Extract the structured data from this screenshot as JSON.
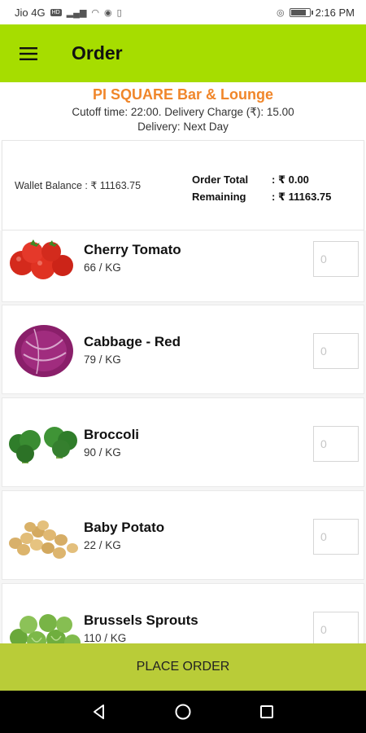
{
  "status_bar": {
    "carrier": "Jio 4G",
    "network_badge": "HD",
    "battery_level": 0.85,
    "time": "2:16 PM"
  },
  "app_bar": {
    "title": "Order",
    "menu_icon": "hamburger-menu-icon"
  },
  "store": {
    "name": "PI SQUARE Bar & Lounge",
    "cutoff_line": "Cutoff time: 22:00. Delivery Charge (₹): 15.00",
    "delivery_line": "Delivery: Next Day"
  },
  "wallet": {
    "balance_text": "Wallet Balance  : ₹ 11163.75",
    "order_total_label": "Order Total",
    "order_total_value": ": ₹ 0.00",
    "remaining_label": "Remaining",
    "remaining_value": ": ₹ 11163.75"
  },
  "products": [
    {
      "name": "Cherry Tomato",
      "price": "66 / KG",
      "qty_placeholder": "0",
      "image": "cherry-tomato"
    },
    {
      "name": "Cabbage - Red",
      "price": "79 / KG",
      "qty_placeholder": "0",
      "image": "red-cabbage"
    },
    {
      "name": "Broccoli",
      "price": "90 / KG",
      "qty_placeholder": "0",
      "image": "broccoli"
    },
    {
      "name": "Baby Potato",
      "price": "22 / KG",
      "qty_placeholder": "0",
      "image": "baby-potato"
    },
    {
      "name": "Brussels Sprouts",
      "price": "110 / KG",
      "qty_placeholder": "0",
      "image": "brussels-sprouts"
    }
  ],
  "place_order_label": "PLACE ORDER",
  "colors": {
    "app_bar": "#a6dd00",
    "store_name": "#f0862a",
    "place_order_bg": "#b9cc38"
  },
  "nav": {
    "back_icon": "back-triangle-icon",
    "home_icon": "home-circle-icon",
    "recents_icon": "recents-square-icon"
  }
}
